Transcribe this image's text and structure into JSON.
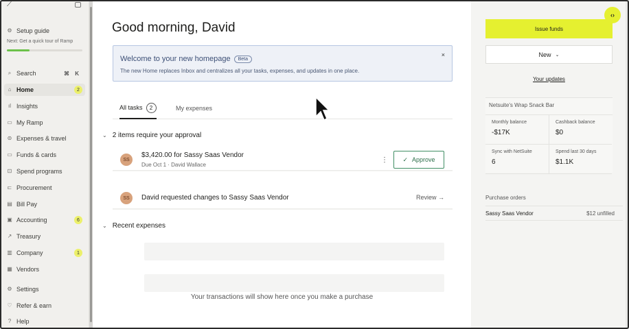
{
  "sidebar": {
    "setup": {
      "label": "Setup guide",
      "sub": "Next: Get a quick tour of Ramp",
      "progress": 0.3
    },
    "search": {
      "label": "Search",
      "shortcut": "⌘ K"
    },
    "items": [
      {
        "label": "Home",
        "badge": "2",
        "icon": "home-icon"
      },
      {
        "label": "Insights",
        "badge": "",
        "icon": "chart-icon"
      },
      {
        "label": "My Ramp",
        "badge": "",
        "icon": "user-icon"
      },
      {
        "label": "Expenses & travel",
        "badge": "",
        "icon": "receipt-icon"
      },
      {
        "label": "Funds & cards",
        "badge": "",
        "icon": "card-icon"
      },
      {
        "label": "Spend programs",
        "badge": "",
        "icon": "program-icon"
      },
      {
        "label": "Procurement",
        "badge": "",
        "icon": "cart-icon"
      },
      {
        "label": "Bill Pay",
        "badge": "",
        "icon": "bill-icon"
      },
      {
        "label": "Accounting",
        "badge": "6",
        "icon": "ledger-icon"
      },
      {
        "label": "Treasury",
        "badge": "",
        "icon": "treasury-icon"
      },
      {
        "label": "Company",
        "badge": "1",
        "icon": "building-icon"
      },
      {
        "label": "Vendors",
        "badge": "",
        "icon": "vendor-icon"
      },
      {
        "label": "Settings",
        "badge": "",
        "icon": "gear-icon"
      },
      {
        "label": "Refer & earn",
        "badge": "",
        "icon": "gift-icon"
      },
      {
        "label": "Help",
        "badge": "",
        "icon": "help-icon"
      }
    ]
  },
  "main": {
    "greeting": "Good morning, David",
    "welcome": {
      "title": "Welcome to your new homepage",
      "badge": "Beta",
      "desc": "The new Home replaces Inbox and centralizes all your tasks, expenses, and updates in one place.",
      "close": "×"
    },
    "tabs": {
      "all": "All tasks",
      "all_count": "2",
      "mine": "My expenses"
    },
    "approval": {
      "heading": "2 items require your approval",
      "task1": {
        "avatar": "SS",
        "title": "$3,420.00 for Sassy Saas Vendor",
        "sub": "Due Oct 1 · David Wallace",
        "approve": "Approve"
      },
      "task2": {
        "avatar": "SS",
        "title": "David requested changes to Sassy Saas Vendor",
        "review": "Review →"
      }
    },
    "recent": {
      "heading": "Recent expenses",
      "empty": "Your transactions will show here once you make a purchase"
    }
  },
  "right": {
    "issue": "Issue funds",
    "new": "New",
    "updates": "Your updates",
    "card": {
      "title": "Netsuite's Wrap Snack Bar",
      "cells": [
        {
          "label": "Monthly balance",
          "value": "-$17K"
        },
        {
          "label": "Cashback balance",
          "value": "$0"
        },
        {
          "label": "Sync with NetSuite",
          "value": "6"
        },
        {
          "label": "Spend last 30 days",
          "value": "$1.1K"
        }
      ]
    },
    "po": {
      "title": "Purchase orders",
      "vendor": "Sassy Saas Vendor",
      "value": "$12 unfilled"
    }
  },
  "corner": "‹›"
}
